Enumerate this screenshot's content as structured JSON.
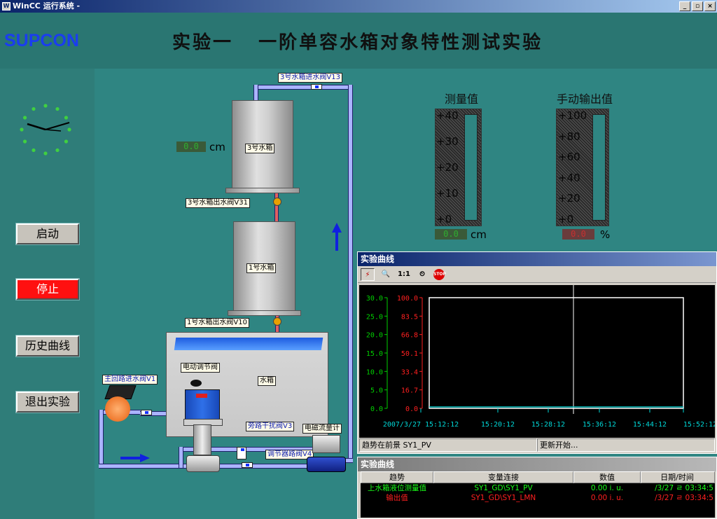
{
  "window": {
    "title": "WinCC 运行系统 -",
    "min": "_",
    "restore": "▫",
    "close": "×"
  },
  "header": {
    "logo": "SUPCON",
    "title": "实验一   一阶单容水箱对象特性测试实验"
  },
  "nav": {
    "start": "启动",
    "stop": "停止",
    "history": "历史曲线",
    "exit": "退出实验"
  },
  "colors": {
    "start_bg": "#c7c3bb",
    "stop_bg": "#ff1010",
    "panel": "#2f8582"
  },
  "process": {
    "tank3": "3号水箱",
    "tank1": "1号水箱",
    "sump": "水箱",
    "v13": "3号水箱进水阀V13",
    "v31": "3号水箱出水阀V31",
    "v10": "1号水箱出水阀V10",
    "v1": "主回路进水阀V1",
    "v3": "旁路干扰阀V3",
    "v4": "调节器路阀V4",
    "ecv": "电动调节阀",
    "flowmeter": "电磁流量计",
    "level_readout": "0.0",
    "level_unit": "cm"
  },
  "bars": {
    "measured": {
      "label": "测量值",
      "ticks": [
        "+40",
        "+30",
        "+20",
        "+10",
        "+0"
      ],
      "readout": "0.0",
      "unit": "cm",
      "level": 0
    },
    "manual": {
      "label": "手动输出值",
      "ticks": [
        "+100",
        "+80",
        "+60",
        "+40",
        "+20",
        "+0"
      ],
      "readout": "0.0",
      "unit": "%",
      "level": 0
    }
  },
  "trend": {
    "title": "实验曲线",
    "tools": [
      "⚡",
      "🔍",
      "1:1",
      "⏲",
      "STOP"
    ],
    "status_left": "趋势在前景 SY1_PV",
    "status_right": "更新开始..."
  },
  "chart_data": {
    "type": "line",
    "left_axis": {
      "ticks": [
        "30.0",
        "25.0",
        "20.0",
        "15.0",
        "10.0",
        "5.0",
        "0.0"
      ],
      "color": "#00d000",
      "range": [
        0,
        30
      ]
    },
    "right_axis": {
      "ticks": [
        "100.0",
        "83.5",
        "66.8",
        "50.1",
        "33.4",
        "16.7",
        "0.0"
      ],
      "color": "#ff2020",
      "range": [
        0,
        100
      ]
    },
    "x_ticks": [
      "2007/3/27 15:12:12",
      "15:20:12",
      "15:28:12",
      "15:36:12",
      "15:44:12",
      "15:52:12"
    ],
    "series": [
      {
        "name": "上水箱液位测量值",
        "color": "#00c8c8",
        "values": [
          0,
          0,
          0,
          0,
          0,
          0
        ]
      }
    ]
  },
  "table": {
    "title": "实验曲线",
    "headers": [
      "趋势",
      "变量连接",
      "数值",
      "日期/时间"
    ],
    "rows": [
      {
        "trend": "上水箱液位测量值",
        "var": "SY1_GD\\SY1_PV",
        "value": "0.00 i. u.",
        "date": "/3/27  ㄹ 03:34:5",
        "color": "#18ff18"
      },
      {
        "trend": "输出值",
        "var": "SY1_GD\\SY1_LMN",
        "value": "0.00 i. u.",
        "date": "/3/27  ㄹ 03:34:5",
        "color": "#ff2020"
      }
    ]
  }
}
